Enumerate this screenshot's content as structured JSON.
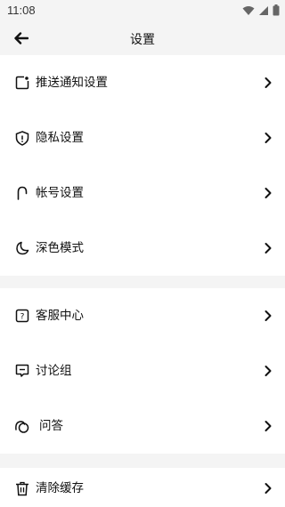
{
  "status_bar": {
    "time": "11:08"
  },
  "header": {
    "title": "设置"
  },
  "groups": [
    {
      "items": [
        {
          "label": "推送通知设置",
          "icon": "notification-icon"
        },
        {
          "label": "隐私设置",
          "icon": "shield-icon"
        },
        {
          "label": "帐号设置",
          "icon": "account-icon"
        },
        {
          "label": "深色模式",
          "icon": "moon-icon"
        }
      ]
    },
    {
      "items": [
        {
          "label": "客服中心",
          "icon": "help-icon"
        },
        {
          "label": "讨论组",
          "icon": "chat-icon"
        },
        {
          "label": "问答",
          "icon": "qa-icon"
        }
      ]
    },
    {
      "items": [
        {
          "label": "清除缓存",
          "icon": "trash-icon"
        }
      ]
    }
  ]
}
